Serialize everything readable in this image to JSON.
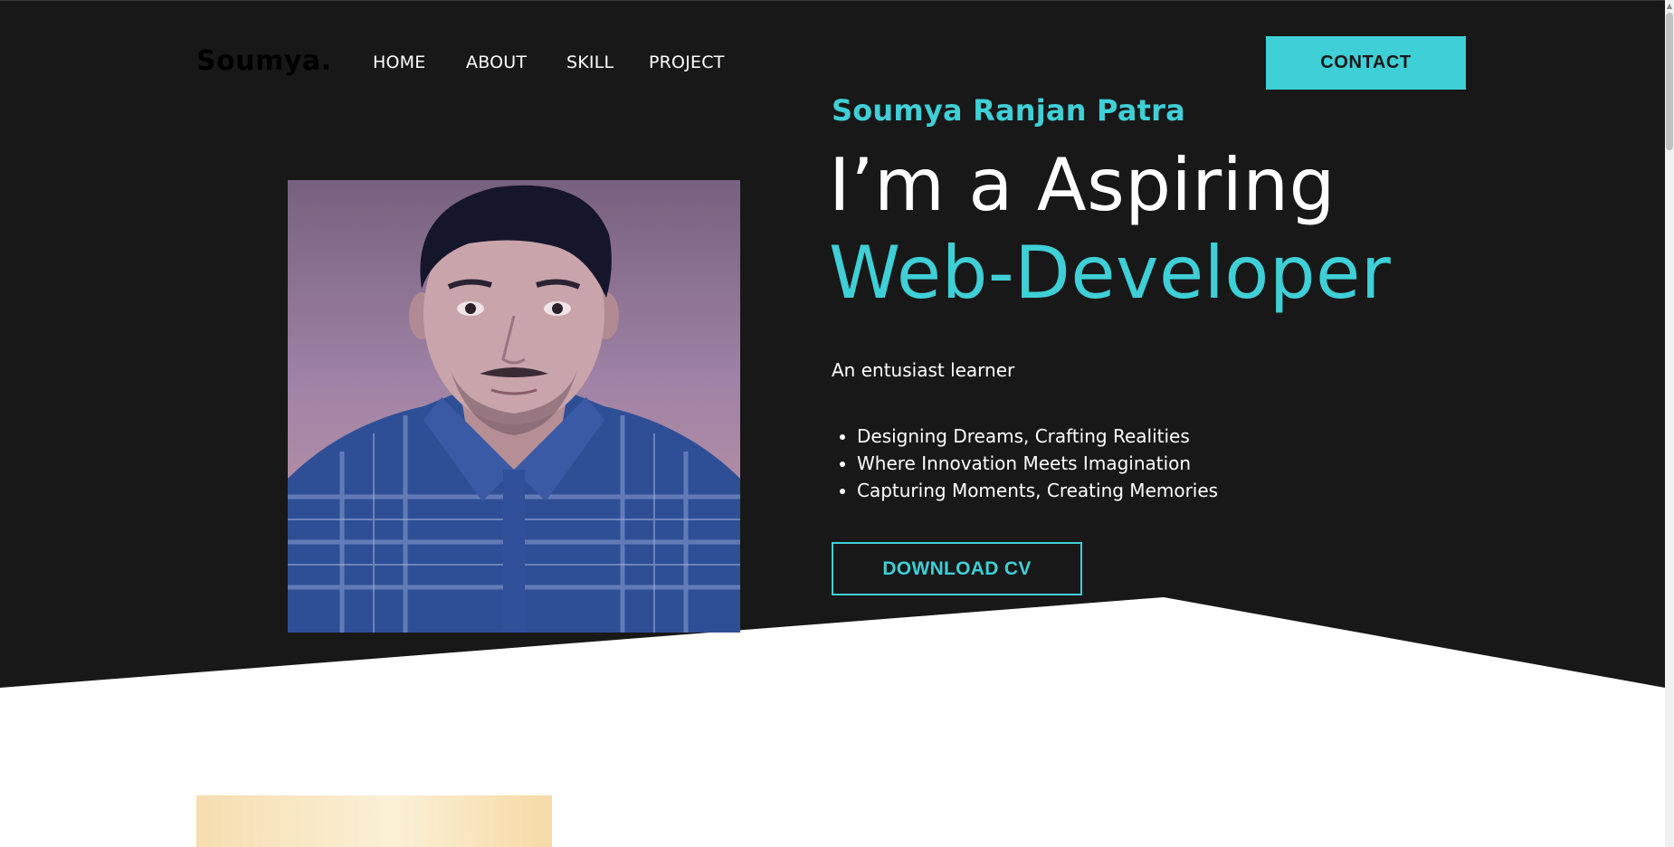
{
  "brand": {
    "logo": "Soumya."
  },
  "nav": {
    "items": [
      {
        "label": "HOME"
      },
      {
        "label": "ABOUT"
      },
      {
        "label": "SKILL"
      },
      {
        "label": "PROJECT"
      }
    ],
    "contact_label": "CONTACT"
  },
  "hero": {
    "name": "Soumya Ranjan Patra",
    "headline_line1": "I’m a Aspiring",
    "headline_line2": "Web-Developer",
    "tagline": "An entusiast learner",
    "bullets": [
      "Designing Dreams, Crafting Realities",
      "Where Innovation Meets Imagination",
      "Capturing Moments, Creating Memories"
    ],
    "download_label": "DOWNLOAD CV"
  },
  "colors": {
    "accent": "#3fcfd6",
    "hero_background": "#181818",
    "page_background": "#ffffff"
  }
}
